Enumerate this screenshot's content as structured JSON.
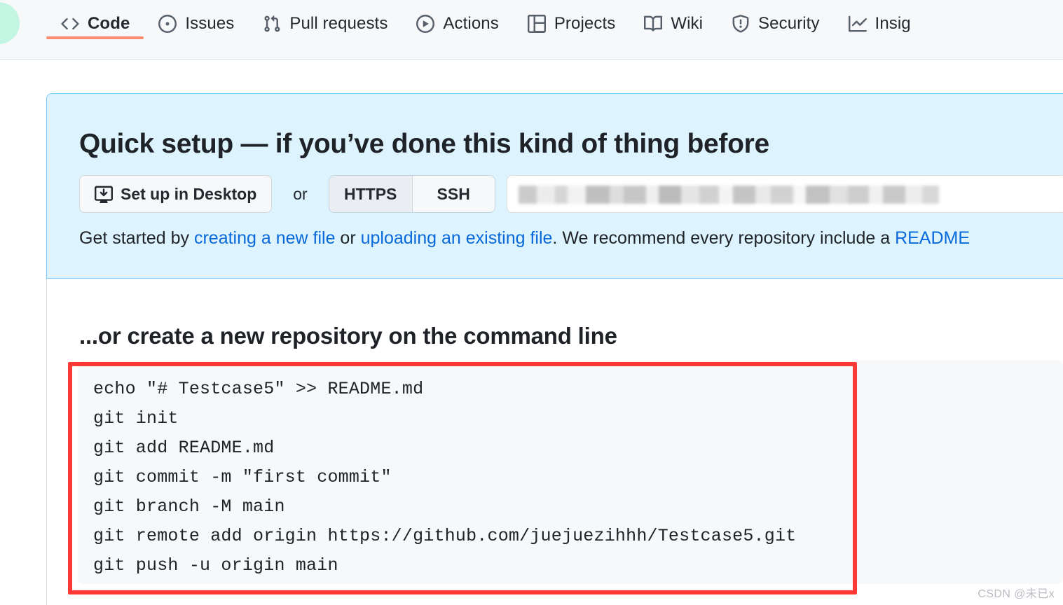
{
  "nav": {
    "items": [
      {
        "label": "Code",
        "icon": "code-icon",
        "active": true
      },
      {
        "label": "Issues",
        "icon": "issue-opened-icon",
        "active": false
      },
      {
        "label": "Pull requests",
        "icon": "git-pull-request-icon",
        "active": false
      },
      {
        "label": "Actions",
        "icon": "play-icon",
        "active": false
      },
      {
        "label": "Projects",
        "icon": "table-icon",
        "active": false
      },
      {
        "label": "Wiki",
        "icon": "book-icon",
        "active": false
      },
      {
        "label": "Security",
        "icon": "shield-icon",
        "active": false
      },
      {
        "label": "Insig",
        "icon": "graph-icon",
        "active": false
      }
    ]
  },
  "quick_setup": {
    "title": "Quick setup — if you’ve done this kind of thing before",
    "desktop_button": "Set up in Desktop",
    "or_label": "or",
    "protocols": [
      {
        "label": "HTTPS",
        "selected": true
      },
      {
        "label": "SSH",
        "selected": false
      }
    ],
    "url_value": "",
    "get_started": {
      "prefix": "Get started by ",
      "link1": "creating a new file",
      "middle": " or ",
      "link2": "uploading an existing file",
      "suffix": ". We recommend every repository include a ",
      "link3": "README"
    }
  },
  "command_line": {
    "title": "...or create a new repository on the command line",
    "commands": [
      "echo \"# Testcase5\" >> README.md",
      "git init",
      "git add README.md",
      "git commit -m \"first commit\"",
      "git branch -M main",
      "git remote add origin https://github.com/juejuezihhh/Testcase5.git",
      "git push -u origin main"
    ]
  },
  "annotation": {
    "color": "#fa3a33"
  },
  "watermark": "CSDN @未已x"
}
